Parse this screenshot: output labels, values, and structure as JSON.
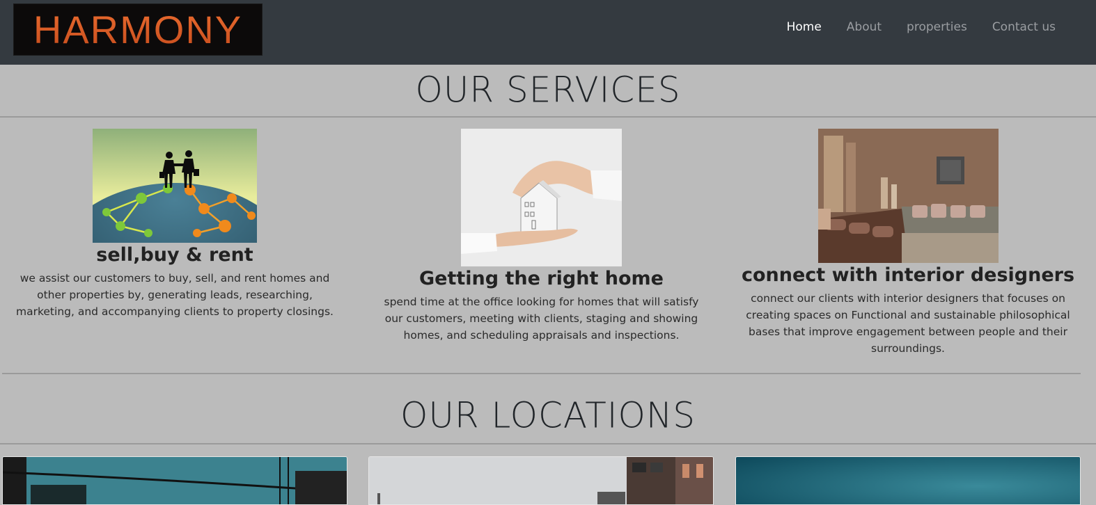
{
  "header": {
    "logo_text": "HARMONY",
    "nav": [
      {
        "label": "Home",
        "active": true
      },
      {
        "label": "About"
      },
      {
        "label": "properties"
      },
      {
        "label": "Contact us"
      }
    ]
  },
  "services": {
    "title": "OUR SERVICES",
    "items": [
      {
        "title": "sell,buy & rent",
        "text": "we assist our customers to buy, sell, and rent homes and other properties by, generating leads, researching, marketing, and accompanying clients to property closings.",
        "image": "handshake-globe-image"
      },
      {
        "title": "Getting the right home",
        "text": "spend time at the office looking for homes that will satisfy our customers, meeting with clients, staging and showing homes, and scheduling appraisals and inspections.",
        "image": "hand-holding-house-image"
      },
      {
        "title": "connect with interior designers",
        "text": "connect our clients with interior designers that focuses on creating spaces on Functional and sustainable philosophical bases that improve engagement between people and their surroundings.",
        "image": "living-room-interior-image"
      }
    ]
  },
  "locations": {
    "title": "OUR LOCATIONS"
  },
  "colors": {
    "navbar": "#343a40",
    "page_background": "#bbbbbb",
    "logo_text": "#e0602a",
    "nav_active": "#ffffff",
    "nav_inactive": "#9a9da1"
  }
}
